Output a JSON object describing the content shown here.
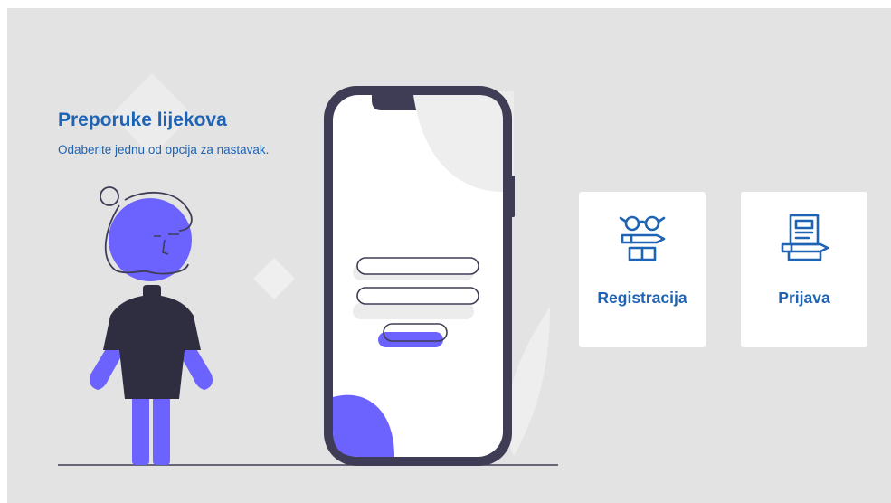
{
  "header": {
    "title": "Preporuke lijekova",
    "subtitle": "Odaberite jednu od opcija za nastavak."
  },
  "options": [
    {
      "label": "Registracija",
      "icon": "glasses-pen-book-icon"
    },
    {
      "label": "Prijava",
      "icon": "document-pen-icon"
    }
  ],
  "illustration": {
    "description_icon": "person-with-phone-login-illustration"
  },
  "colors": {
    "accent": "#1e63b4",
    "figure_purple": "#6c63ff",
    "dark": "#3f3d56",
    "background": "#e3e3e3",
    "card": "#ffffff"
  }
}
